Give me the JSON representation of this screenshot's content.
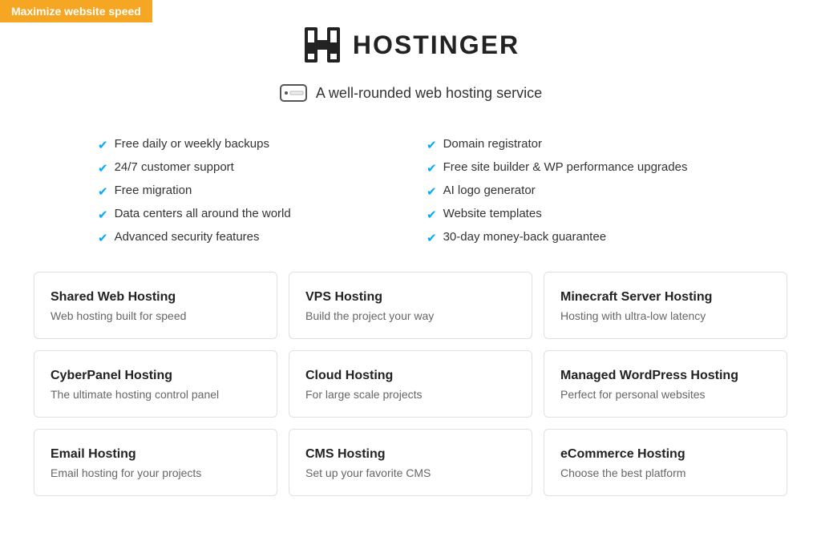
{
  "banner": {
    "text": "Maximize website speed"
  },
  "logo": {
    "text": "HOSTINGER"
  },
  "tagline": {
    "text": "A well-rounded web hosting service"
  },
  "features": {
    "left": [
      "Free daily or weekly backups",
      "24/7 customer support",
      "Free migration",
      "Data centers all around the world",
      "Advanced security features"
    ],
    "right": [
      "Domain registrator",
      "Free site builder & WP performance upgrades",
      "AI logo generator",
      "Website templates",
      "30-day money-back guarantee"
    ]
  },
  "hosting_cards": [
    {
      "title": "Shared Web Hosting",
      "subtitle": "Web hosting built for speed"
    },
    {
      "title": "VPS Hosting",
      "subtitle": "Build the project your way"
    },
    {
      "title": "Minecraft Server Hosting",
      "subtitle": "Hosting with ultra-low latency"
    },
    {
      "title": "CyberPanel Hosting",
      "subtitle": "The ultimate hosting control panel"
    },
    {
      "title": "Cloud Hosting",
      "subtitle": "For large scale projects"
    },
    {
      "title": "Managed WordPress Hosting",
      "subtitle": "Perfect for personal websites"
    },
    {
      "title": "Email Hosting",
      "subtitle": "Email hosting for your projects"
    },
    {
      "title": "CMS Hosting",
      "subtitle": "Set up your favorite CMS"
    },
    {
      "title": "eCommerce Hosting",
      "subtitle": "Choose the best platform"
    }
  ]
}
